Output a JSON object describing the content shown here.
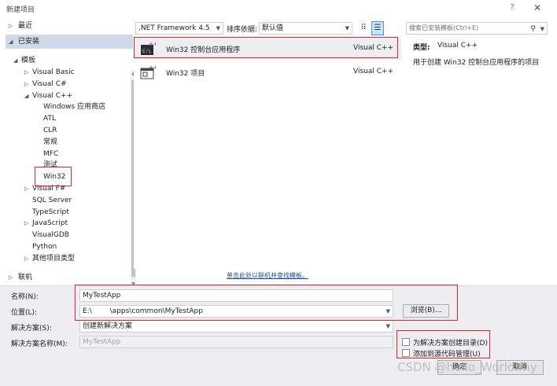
{
  "window": {
    "title": "新建项目",
    "help_glyph": "?",
    "close_glyph": "✕"
  },
  "left_panel": {
    "recent_label": "最近",
    "installed_label": "已安装",
    "templates_label": "模板",
    "online_label": "联机",
    "tree": [
      {
        "label": "Visual Basic",
        "expand": "▷"
      },
      {
        "label": "Visual C#",
        "expand": "▷"
      },
      {
        "label": "Visual C++",
        "expand": "◢"
      },
      {
        "label": "Windows 应用商店",
        "expand": ""
      },
      {
        "label": "ATL",
        "expand": ""
      },
      {
        "label": "CLR",
        "expand": ""
      },
      {
        "label": "常规",
        "expand": ""
      },
      {
        "label": "MFC",
        "expand": ""
      },
      {
        "label": "测试",
        "expand": ""
      },
      {
        "label": "Win32",
        "expand": ""
      },
      {
        "label": "Visual F#",
        "expand": "▷"
      },
      {
        "label": "SQL Server",
        "expand": ""
      },
      {
        "label": "TypeScript",
        "expand": ""
      },
      {
        "label": "JavaScript",
        "expand": "▷"
      },
      {
        "label": "VisualGDB",
        "expand": ""
      },
      {
        "label": "Python",
        "expand": ""
      },
      {
        "label": "其他项目类型",
        "expand": "▷"
      }
    ]
  },
  "toolbar": {
    "framework": ".NET Framework 4.5",
    "sort_label": "排序依据:",
    "sort_value": "默认值"
  },
  "search": {
    "placeholder": "搜索已安装模板(Ctrl+E)"
  },
  "templates": [
    {
      "name": "Win32 控制台应用程序",
      "language": "Visual C++",
      "icon": "console-app-icon"
    },
    {
      "name": "Win32 项目",
      "language": "Visual C++",
      "icon": "win32-project-icon"
    }
  ],
  "info": {
    "type_label": "类型:",
    "type_value": "Visual C++",
    "description": "用于创建 Win32 控制台应用程序的项目"
  },
  "online_link": "单击此处以联机并查找模板。",
  "form": {
    "name_label": "名称(N):",
    "name_value": "MyTestApp",
    "location_label": "位置(L):",
    "location_value": "E:\\        \\apps\\common\\MyTestApp",
    "solution_label": "解决方案(S):",
    "solution_value": "创建新解决方案",
    "solution_name_label": "解决方案名称(M):",
    "solution_name_value": "MyTestApp",
    "browse_label": "浏览(B)...",
    "create_dir_label": "为解决方案创建目录(D)",
    "add_source_control_label": "添加到源代码管理(U)",
    "ok_label": "确定",
    "cancel_label": "取消"
  },
  "watermark": "CSDN @hello_World.my",
  "colors": {
    "annotation": "#e0262b",
    "selection": "#cfd9e9",
    "form_background": "#eeeef2",
    "link": "#1a4aa8"
  }
}
